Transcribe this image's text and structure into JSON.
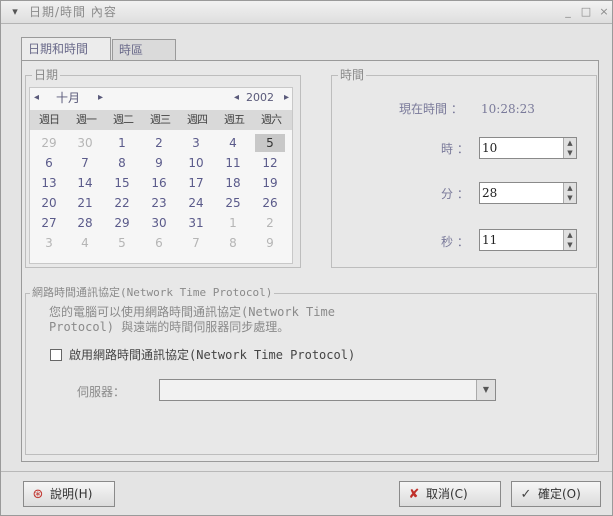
{
  "window": {
    "title": "日期/時間 內容",
    "menu_icon": "▾",
    "min_icon": "_",
    "max_icon": "□",
    "close_icon": "×"
  },
  "tabs": [
    {
      "label": "日期和時間"
    },
    {
      "label": "時區"
    }
  ],
  "date_group": {
    "legend": "日期"
  },
  "calendar": {
    "prev_month": "◂",
    "month": "十月",
    "next_month": "▸",
    "prev_year": "◂",
    "year": "2002",
    "next_year": "▸",
    "weekdays": [
      "週日",
      "週一",
      "週二",
      "週三",
      "週四",
      "週五",
      "週六"
    ],
    "weeks": [
      [
        "29",
        "30",
        "1",
        "2",
        "3",
        "4",
        "5"
      ],
      [
        "6",
        "7",
        "8",
        "9",
        "10",
        "11",
        "12"
      ],
      [
        "13",
        "14",
        "15",
        "16",
        "17",
        "18",
        "19"
      ],
      [
        "20",
        "21",
        "22",
        "23",
        "24",
        "25",
        "26"
      ],
      [
        "27",
        "28",
        "29",
        "30",
        "31",
        "1",
        "2"
      ],
      [
        "3",
        "4",
        "5",
        "6",
        "7",
        "8",
        "9"
      ]
    ]
  },
  "time_group": {
    "legend": "時間",
    "current_label": "現在時間 ：",
    "current_value": "10:28:23",
    "hour_label": "時 ：",
    "hour_value": "10",
    "minute_label": "分 ：",
    "minute_value": "28",
    "second_label": "秒 ：",
    "second_value": "11"
  },
  "ntp_group": {
    "legend": "網路時間通訊協定(Network Time Protocol)",
    "description": "您的電腦可以使用網路時間通訊協定(Network Time\nProtocol) 與遠端的時間伺服器同步處理。",
    "checkbox_label": "啟用網路時間通訊協定(Network Time Protocol)",
    "server_label": "伺服器：",
    "server_value": ""
  },
  "buttons": {
    "help": "說明(H)",
    "cancel": "取消(C)",
    "ok": "確定(O)"
  }
}
